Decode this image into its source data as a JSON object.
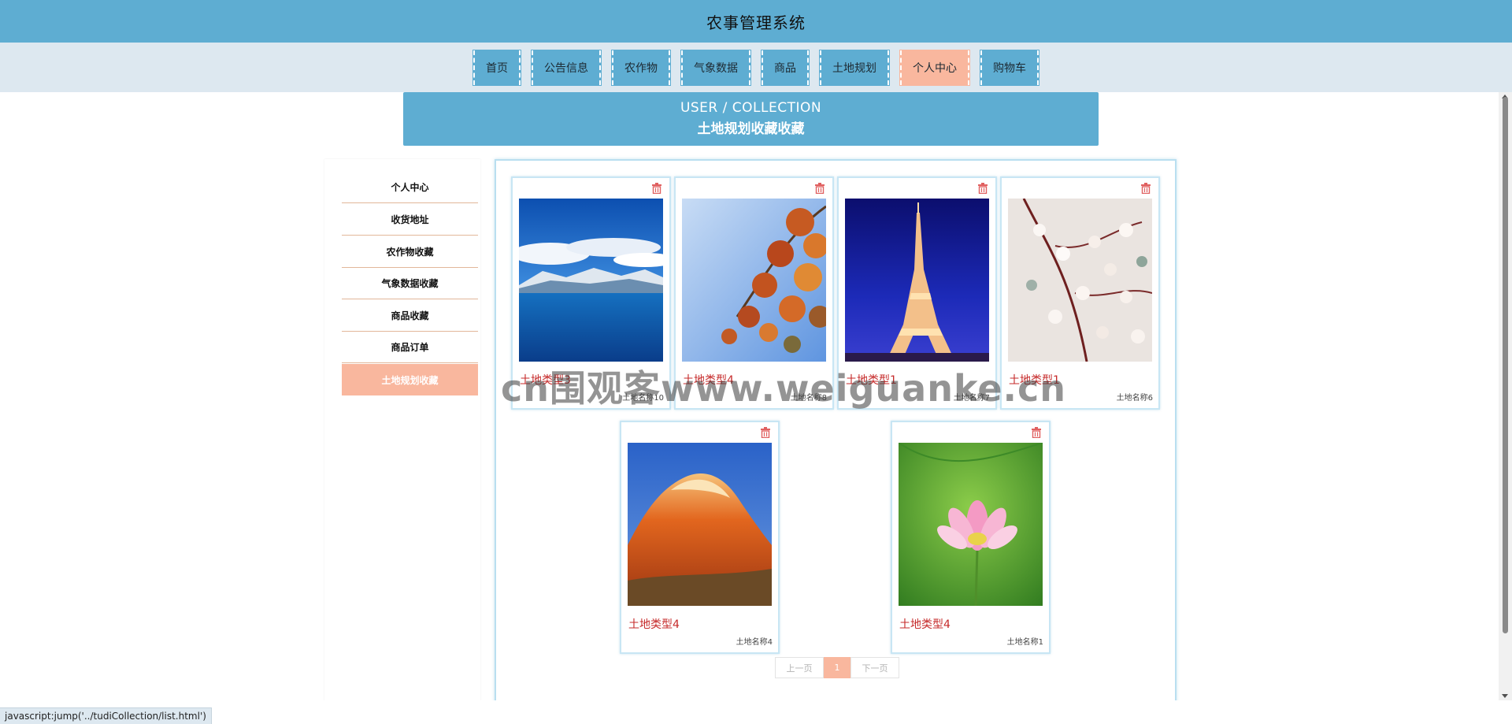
{
  "header": {
    "title": "农事管理系统"
  },
  "nav": {
    "items": [
      {
        "label": "首页"
      },
      {
        "label": "公告信息"
      },
      {
        "label": "农作物"
      },
      {
        "label": "气象数据"
      },
      {
        "label": "商品"
      },
      {
        "label": "土地规划"
      },
      {
        "label": "个人中心",
        "active": true
      },
      {
        "label": "购物车"
      }
    ]
  },
  "banner": {
    "en": "USER / COLLECTION",
    "zh": "土地规划收藏收藏"
  },
  "sidebar": {
    "items": [
      {
        "label": "个人中心"
      },
      {
        "label": "收货地址"
      },
      {
        "label": "农作物收藏"
      },
      {
        "label": "气象数据收藏"
      },
      {
        "label": "商品收藏"
      },
      {
        "label": "商品订单"
      },
      {
        "label": "土地规划收藏",
        "active": true
      }
    ]
  },
  "cards": [
    {
      "type": "土地类型3",
      "name": "土地名称10",
      "image": "lake-mountain"
    },
    {
      "type": "土地类型4",
      "name": "土地名称8",
      "image": "autumn-leaves"
    },
    {
      "type": "土地类型1",
      "name": "土地名称7",
      "image": "eiffel-tower"
    },
    {
      "type": "土地类型1",
      "name": "土地名称6",
      "image": "blossom-branch"
    },
    {
      "type": "土地类型4",
      "name": "土地名称4",
      "image": "red-rock"
    },
    {
      "type": "土地类型4",
      "name": "土地名称1",
      "image": "lotus-flower"
    }
  ],
  "pagination": {
    "prev": "上一页",
    "current": "1",
    "next": "下一页"
  },
  "watermark": "cn围观客www.weiguanke.cn",
  "status_bar": "javascript:jump('../tudiCollection/list.html')",
  "colors": {
    "primary": "#5eadd2",
    "accent": "#f9b79e",
    "nav_bg": "#dde8f0",
    "type_text": "#c62a2a"
  }
}
